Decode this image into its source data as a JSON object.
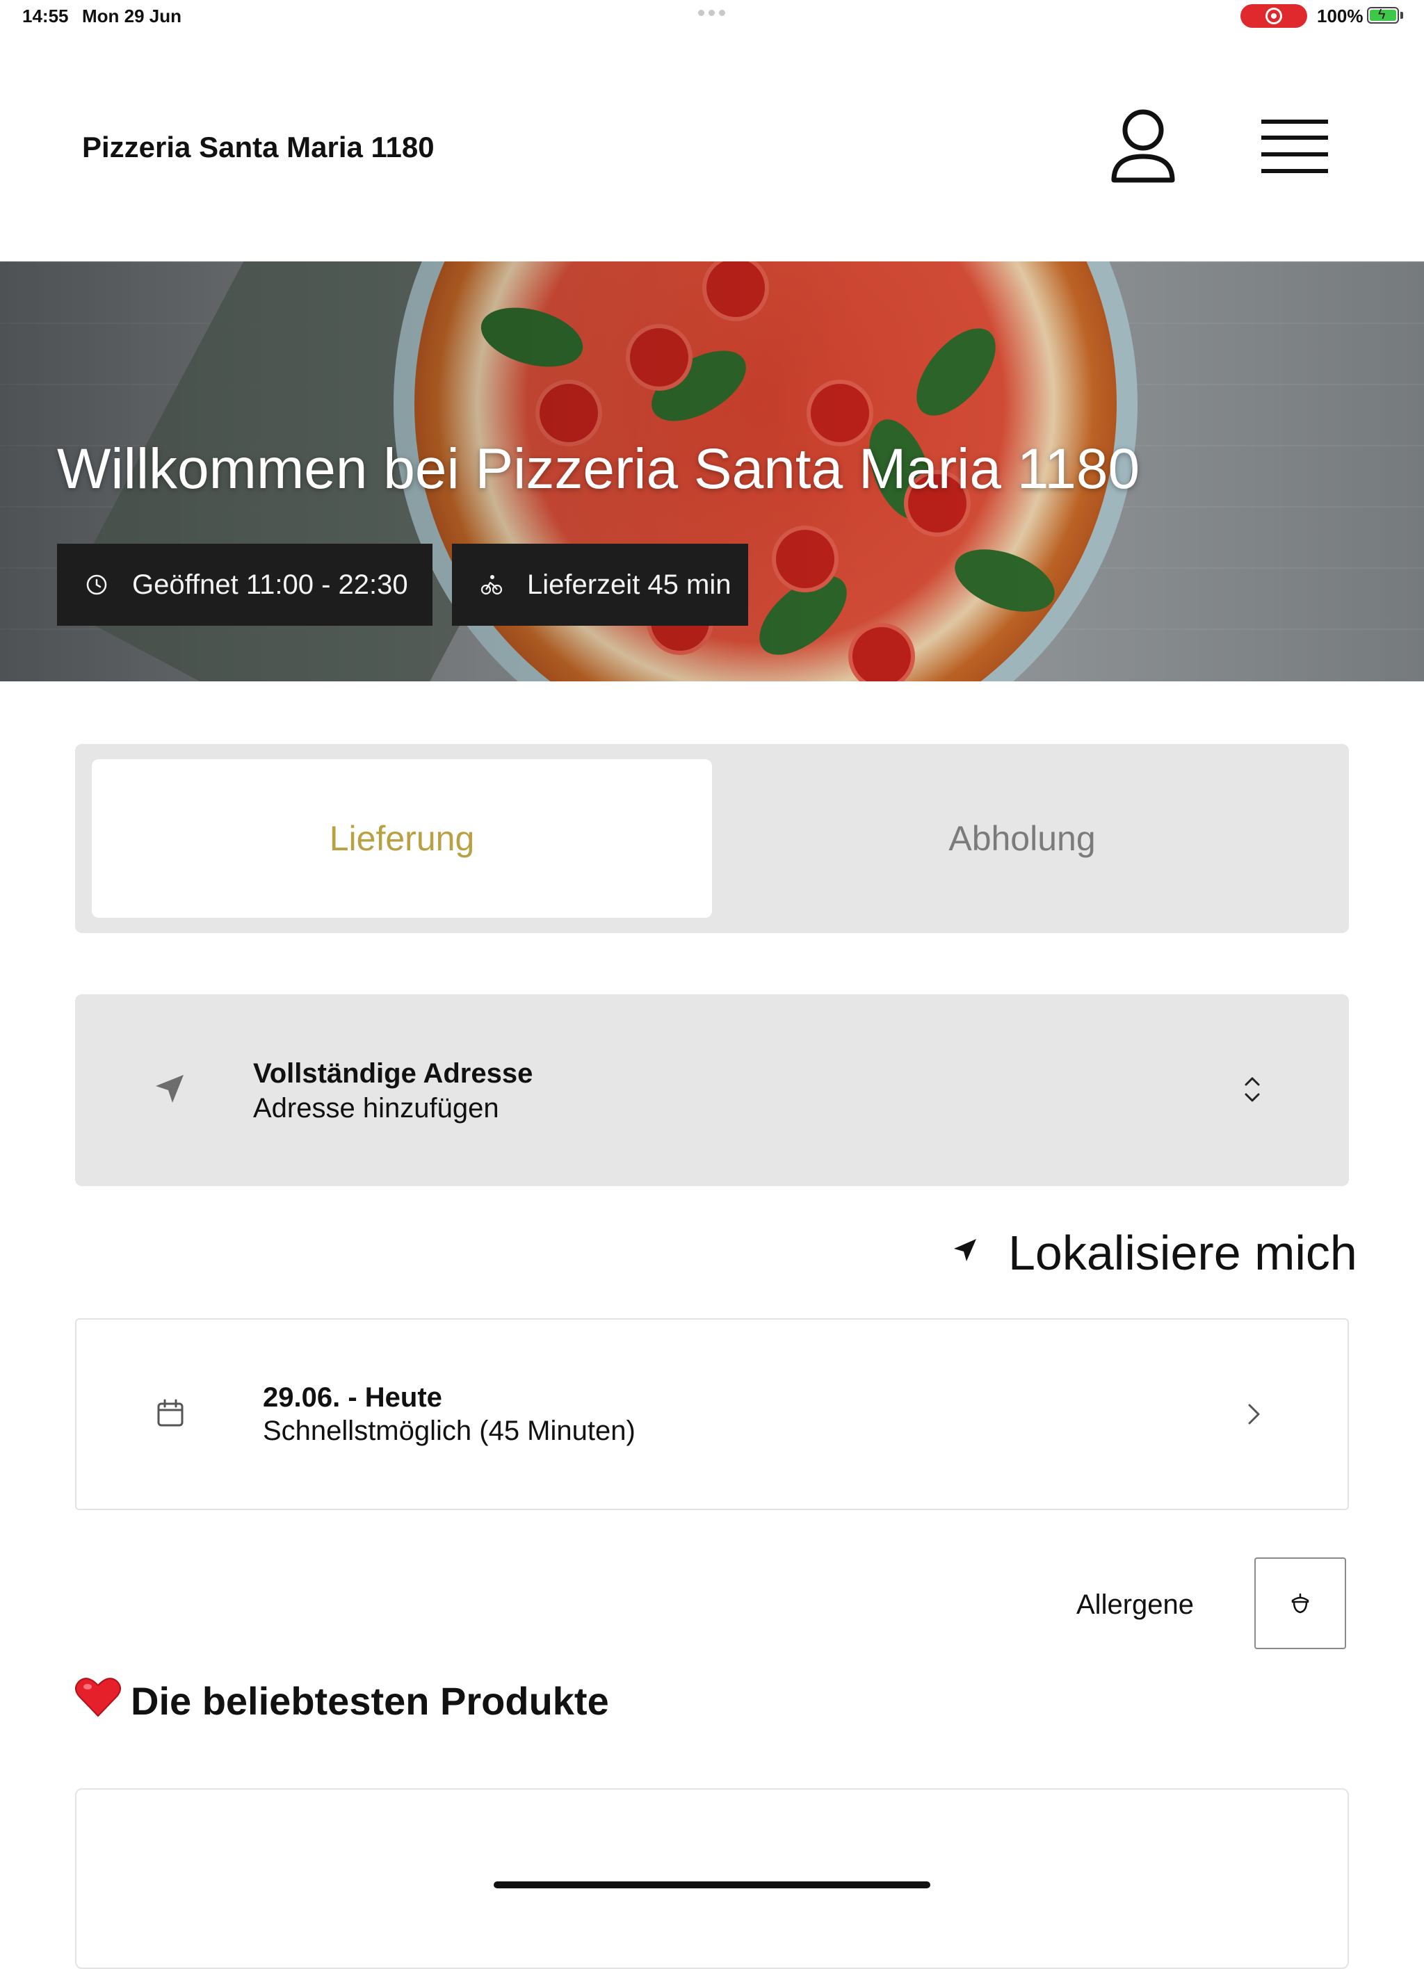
{
  "status_bar": {
    "time": "14:55",
    "date": "Mon 29 Jun",
    "battery": "100%"
  },
  "header": {
    "brand": "Pizzeria Santa Maria 1180",
    "icons": [
      "user-icon",
      "hamburger-menu-icon"
    ]
  },
  "hero": {
    "title": "Willkommen bei Pizzeria Santa Maria 1180",
    "hours": "Geöffnet 11:00 - 22:30",
    "delivery_time": "Lieferzeit 45 min"
  },
  "order_mode": {
    "options": [
      "Lieferung",
      "Abholung"
    ],
    "selected": "Lieferung"
  },
  "address": {
    "title": "Vollständige Adresse",
    "placeholder": "Adresse hinzufügen"
  },
  "locate": {
    "label": "Lokalisiere mich"
  },
  "schedule": {
    "title": "29.06. - Heute",
    "subtitle": "Schnellstmöglich (45 Minuten)"
  },
  "allergens": {
    "label": "Allergene"
  },
  "popular": {
    "title": "Die beliebtesten Produkte"
  },
  "colors": {
    "accent": "#b9a042",
    "chip_bg": "#1d1d1d",
    "card_bg": "#e6e6e6",
    "inactive_text": "#7b7b7b",
    "record": "#e0292c",
    "battery": "#3ec84a"
  }
}
